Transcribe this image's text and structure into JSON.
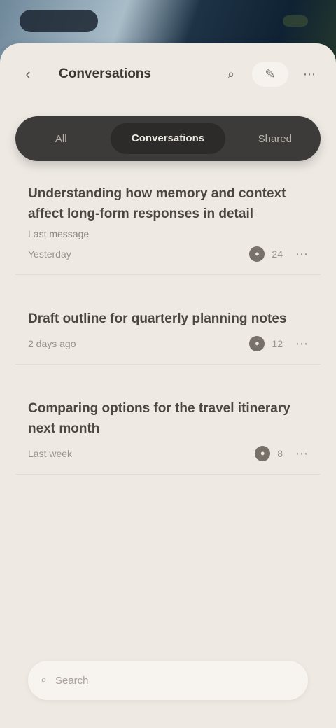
{
  "header": {
    "title": "Conversations",
    "back_icon": "chevron-left-icon",
    "search_icon": "search-icon",
    "new_icon": "compose-icon",
    "menu_icon": "more-icon"
  },
  "tabs": [
    {
      "label": "All"
    },
    {
      "label": "Conversations"
    },
    {
      "label": "Shared"
    }
  ],
  "items": [
    {
      "title": "Understanding how memory and context affect long-form responses in detail",
      "subtitle": "Last message",
      "date": "Yesterday",
      "count": "24"
    },
    {
      "title": "Draft outline for quarterly planning notes",
      "subtitle": "",
      "date": "2 days ago",
      "count": "12"
    },
    {
      "title": "Comparing options for the travel itinerary next month",
      "subtitle": "",
      "date": "Last week",
      "count": "8"
    }
  ],
  "composer": {
    "placeholder": "Search"
  }
}
